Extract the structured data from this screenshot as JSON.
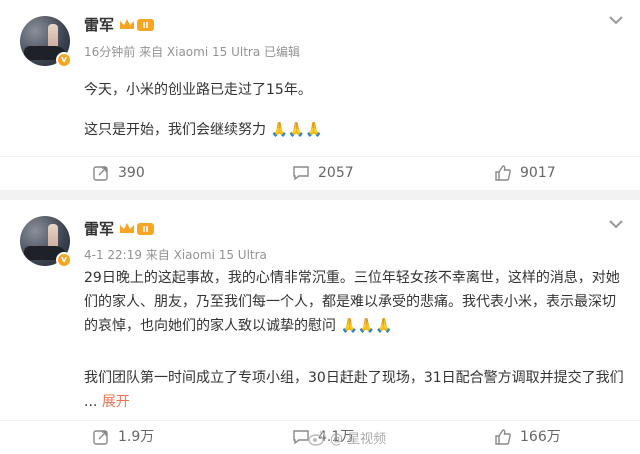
{
  "posts": [
    {
      "author": "雷军",
      "level_badge": "II",
      "verified_badge": "v",
      "meta": "16分钟前 来自 Xiaomi 15 Ultra 已编辑",
      "paragraphs": [
        "今天，小米的创业路已走过了15年。",
        "这只是开始，我们会继续努力 🙏🙏🙏"
      ],
      "repost_count": "390",
      "comment_count": "2057",
      "like_count": "9017"
    },
    {
      "author": "雷军",
      "level_badge": "II",
      "verified_badge": "v",
      "meta": "4-1 22:19 来自 Xiaomi 15 Ultra",
      "paragraphs": [
        "29日晚上的这起事故，我的心情非常沉重。三位年轻女孩不幸离世，这样的消息，对她们的家人、朋友，乃至我们每一个人，都是难以承受的悲痛。我代表小米，表示最深切的哀悼，也向她们的家人致以诚挚的慰问 🙏🙏🙏",
        "我们团队第一时间成立了专项小组，30日赶赴了现场，31日配合警方调取并提交了我们 ..."
      ],
      "expand_label": "展开",
      "repost_count": "1.9万",
      "comment_count": "4.1万",
      "like_count": "166万"
    }
  ],
  "watermark": "@ 星视频",
  "colors": {
    "link": "#eb7350",
    "badge": "#f6a623",
    "meta": "#939393"
  }
}
